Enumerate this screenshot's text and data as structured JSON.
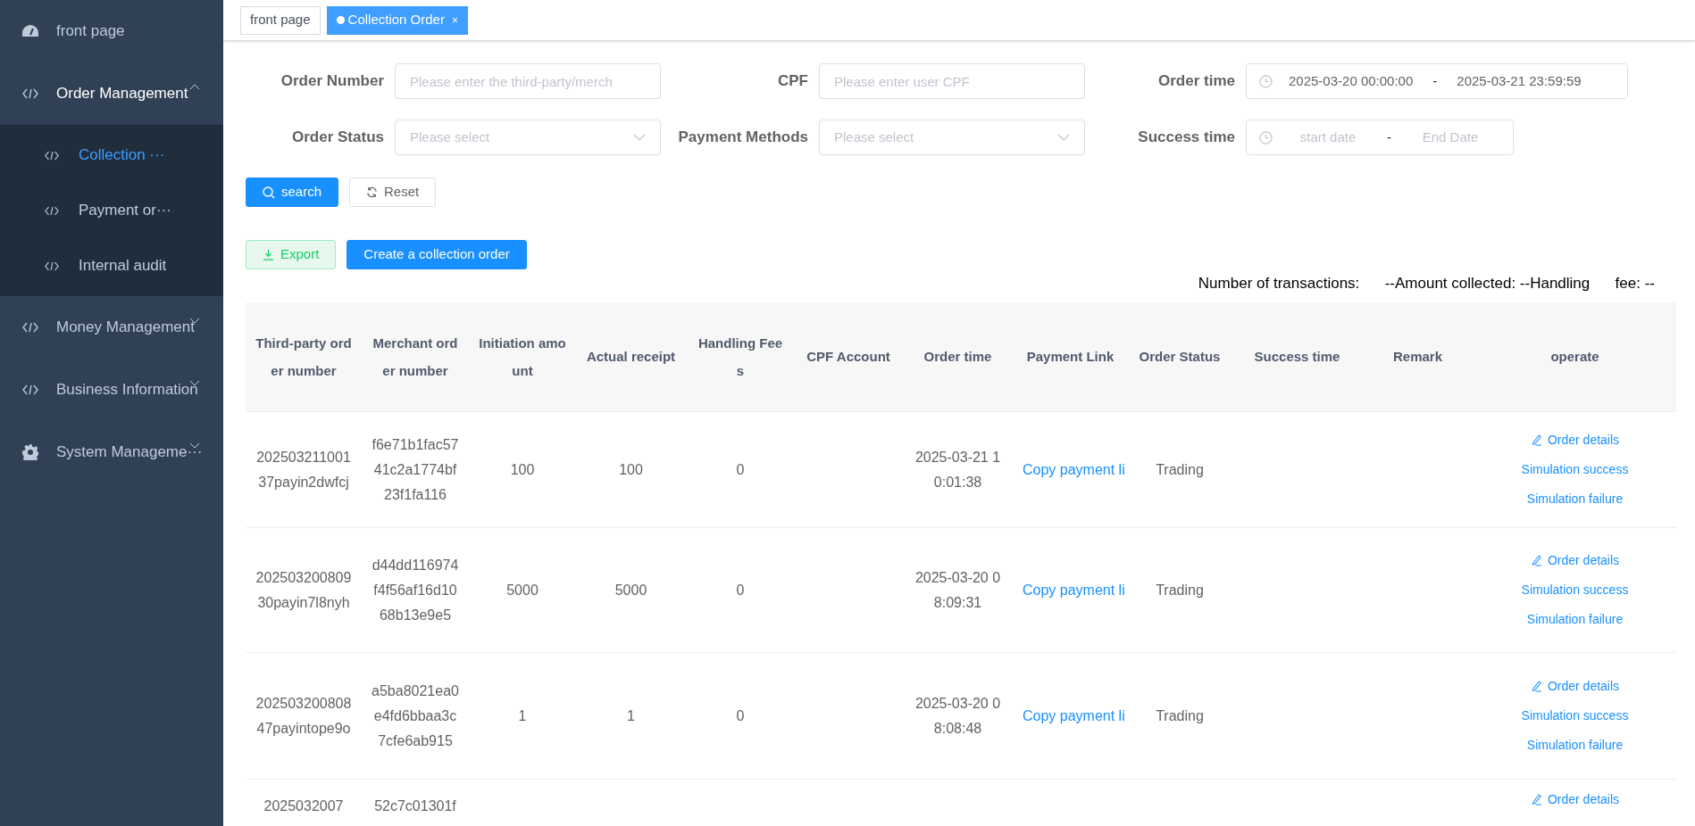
{
  "sidebar": {
    "items": [
      {
        "label": "front page",
        "expanded": false,
        "selected": false
      },
      {
        "label": "Order Management",
        "expanded": true,
        "selected": false,
        "children": [
          {
            "label": "Collection ···",
            "selected": true
          },
          {
            "label": "Payment or···",
            "selected": false
          },
          {
            "label": "Internal audit",
            "selected": false
          }
        ]
      },
      {
        "label": "Money Management",
        "expanded": false,
        "selected": false
      },
      {
        "label": "Business Information",
        "expanded": false,
        "selected": false
      },
      {
        "label": "System Manageme···",
        "expanded": false,
        "selected": false
      }
    ]
  },
  "tabs": [
    {
      "label": "front page",
      "selected": false
    },
    {
      "label": "Collection Order",
      "selected": true,
      "close": "×"
    }
  ],
  "filters": [
    {
      "kind": "input",
      "label": "Order Number",
      "placeholder": "Please enter the third-party/merch"
    },
    {
      "kind": "input",
      "label": "CPF",
      "placeholder": "Please enter user CPF"
    },
    {
      "kind": "daterange",
      "label": "Order time",
      "start": "2025-03-20 00:00:00",
      "end": "2025-03-21 23:59:59",
      "separator": "-"
    },
    {
      "kind": "select",
      "label": "Order Status",
      "placeholder": "Please select"
    },
    {
      "kind": "select",
      "label": "Payment Methods",
      "placeholder": "Please select"
    },
    {
      "kind": "daterange",
      "label": "Success time",
      "start_placeholder": "start date",
      "end_placeholder": "End Date",
      "separator": "-"
    }
  ],
  "search_buttons": [
    {
      "label": "search",
      "kind": "primary"
    },
    {
      "label": "Reset",
      "kind": "plain"
    }
  ],
  "action_buttons": [
    {
      "label": "Export",
      "kind": "export"
    },
    {
      "label": "Create a collection order",
      "kind": "primary"
    }
  ],
  "summary": "Number of transactions:      --Amount collected: --Handling      fee: --",
  "table": {
    "columns": [
      "Third-party order number",
      "Merchant order number",
      "Initiation amount",
      "Actual receipt",
      "Handling Fees",
      "CPF Account",
      "Order time",
      "Payment Link",
      "Order Status",
      "Success time",
      "Remark",
      "operate"
    ],
    "rows": [
      {
        "cells": [
          "20250321100137payin2dwfcj",
          "f6e71b1fac5741c2a1774bf23f1fa116",
          "100",
          "100",
          "0",
          "",
          "2025-03-21 10:01:38",
          "Copy payment li",
          "Trading",
          "",
          ""
        ],
        "actions": [
          "Order details",
          "Simulation success",
          "Simulation failure"
        ]
      },
      {
        "cells": [
          "20250320080930payin7l8nyh",
          "d44dd116974f4f56af16d1068b13e9e5",
          "5000",
          "5000",
          "0",
          "",
          "2025-03-20 08:09:31",
          "Copy payment li",
          "Trading",
          "",
          ""
        ],
        "actions": [
          "Order details",
          "Simulation success",
          "Simulation failure"
        ]
      },
      {
        "cells": [
          "20250320080847payintope9o",
          "a5ba8021ea0e4fd6bbaa3c7cfe6ab915",
          "1",
          "1",
          "0",
          "",
          "2025-03-20 08:08:48",
          "Copy payment li",
          "Trading",
          "",
          ""
        ],
        "actions": [
          "Order details",
          "Simulation success",
          "Simulation failure"
        ]
      },
      {
        "cells": [
          "2025032007",
          "52c7c01301f",
          "",
          "",
          "",
          "",
          "",
          "",
          "",
          "",
          ""
        ],
        "actions": [
          "Order details"
        ]
      }
    ]
  }
}
